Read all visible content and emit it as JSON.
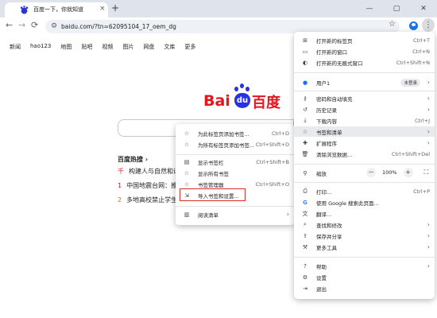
{
  "browser": {
    "tab_title": "百度一下，你就知道",
    "tab_close": "×",
    "new_tab": "+",
    "controls": {
      "minimize": "—",
      "maximize": "▢",
      "close": "✕"
    },
    "nav": {
      "back": "←",
      "forward": "→",
      "reload": "⟳"
    },
    "url": "baidu.com/?tn=62095104_17_oem_dg",
    "star": "☆",
    "menu_icon": "⋮",
    "accent": "#1a73e8"
  },
  "baidu": {
    "nav": [
      "新闻",
      "hao123",
      "地图",
      "贴吧",
      "视频",
      "图片",
      "网盘",
      "文库",
      "更多"
    ],
    "logo": {
      "latin": "Bai",
      "paw": "du",
      "chinese": "百度"
    },
    "hot_title": "百度热搜 ›",
    "hot_items": [
      {
        "num": "千",
        "text": "构建人与自然和谐"
      },
      {
        "num": "1",
        "text": "中国地震台网：推"
      },
      {
        "num": "2",
        "text": "多地高校禁止学生"
      }
    ],
    "brand_red": "#e5141d",
    "brand_blue": "#2932e1"
  },
  "main_menu": {
    "new_tab": {
      "label": "打开新的标签页",
      "shortcut": "Ctrl+T"
    },
    "new_window": {
      "label": "打开新的窗口",
      "shortcut": "Ctrl+N"
    },
    "incognito": {
      "label": "打开新的无痕式窗口",
      "shortcut": "Ctrl+Shift+N"
    },
    "profile": {
      "label": "用户1",
      "badge": "未登录"
    },
    "passwords": {
      "label": "密码和自动填充"
    },
    "history": {
      "label": "历史记录"
    },
    "downloads": {
      "label": "下载内容",
      "shortcut": "Ctrl+J"
    },
    "bookmarks": {
      "label": "书签和清单"
    },
    "extensions": {
      "label": "扩展程序"
    },
    "clear": {
      "label": "清除浏览数据...",
      "shortcut": "Ctrl+Shift+Del"
    },
    "zoom": {
      "label": "缩放",
      "minus": "－",
      "value": "100%",
      "plus": "+",
      "fullscreen": "⛶"
    },
    "print": {
      "label": "打印...",
      "shortcut": "Ctrl+P"
    },
    "google_search": {
      "label": "使用 Google 搜索此页面..."
    },
    "translate": {
      "label": "翻译..."
    },
    "find_edit": {
      "label": "查找和修改"
    },
    "save_share": {
      "label": "保存并分享"
    },
    "more_tools": {
      "label": "更多工具"
    },
    "help": {
      "label": "帮助"
    },
    "settings": {
      "label": "设置"
    },
    "exit": {
      "label": "退出"
    }
  },
  "bookmarks_menu": {
    "add_page": {
      "label": "为此标签页添加书签...",
      "shortcut": "Ctrl+D"
    },
    "add_all": {
      "label": "为所有标签页添加书签...",
      "shortcut": "Ctrl+Shift+D"
    },
    "show_bar": {
      "label": "显示书签栏",
      "shortcut": "Ctrl+Shift+B"
    },
    "show_all": {
      "label": "显示所有书签"
    },
    "manager": {
      "label": "书签管理器",
      "shortcut": "Ctrl+Shift+O"
    },
    "import": {
      "label": "导入书签和设置..."
    },
    "reading_list": {
      "label": "阅读清单"
    }
  },
  "icons": {
    "arrow": "›",
    "new_tab": "⊞",
    "new_window": "▭",
    "incognito": "◐",
    "key": "⚷",
    "history": "↺",
    "download": "⤓",
    "star": "☆",
    "puzzle": "✚",
    "trash": "🗑",
    "zoom": "⚲",
    "print": "⎙",
    "google": "G",
    "translate": "文",
    "find": "⌕",
    "save": "⇪",
    "tools": "⚒",
    "help": "?",
    "gear": "⚙",
    "exit": "⇥",
    "bookmark_bar": "▤",
    "import": "⇲",
    "reading": "▥"
  }
}
